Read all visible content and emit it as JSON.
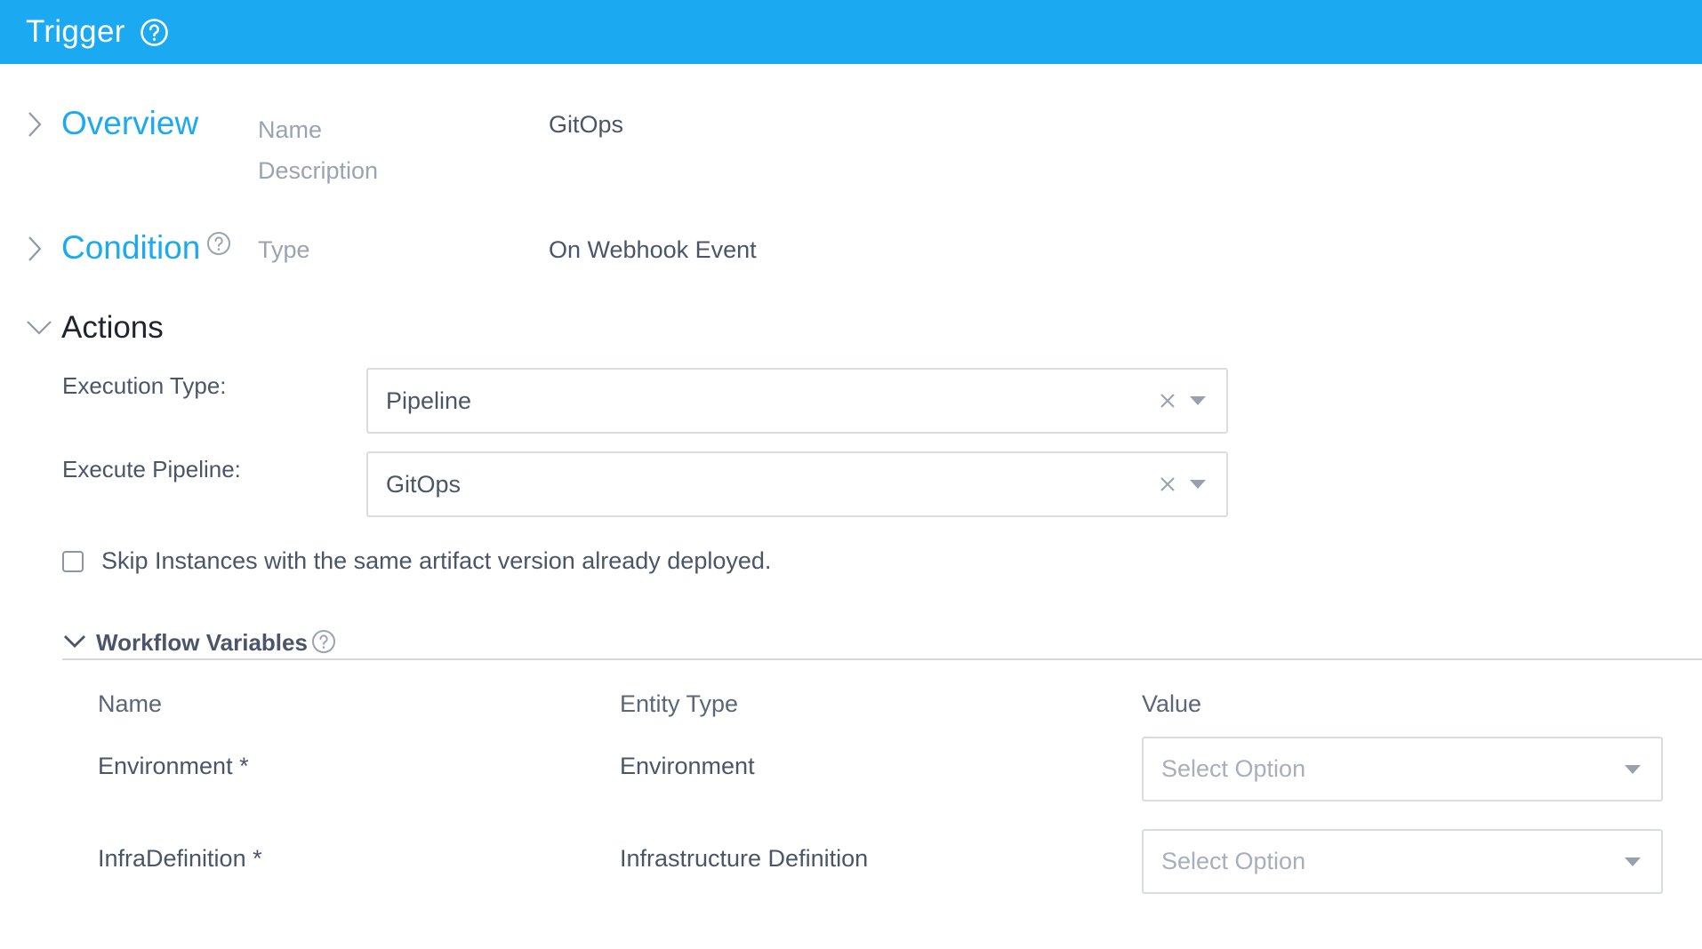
{
  "header": {
    "title": "Trigger",
    "help_icon": "help-circle-icon",
    "bg_color": "#1ba9f2"
  },
  "overview": {
    "heading": "Overview",
    "name_label": "Name",
    "name_value": "GitOps",
    "description_label": "Description"
  },
  "condition": {
    "heading": "Condition",
    "type_label": "Type",
    "type_value": "On Webhook Event"
  },
  "actions": {
    "heading": "Actions",
    "execution_type_label": "Execution Type:",
    "execution_type_value": "Pipeline",
    "execute_pipeline_label": "Execute Pipeline:",
    "execute_pipeline_value": "GitOps",
    "skip_instances_label": "Skip Instances with the same artifact version already deployed.",
    "skip_instances_checked": false
  },
  "workflow_variables": {
    "heading": "Workflow Variables",
    "columns": {
      "name": "Name",
      "entity_type": "Entity Type",
      "value": "Value"
    },
    "rows": [
      {
        "name": "Environment *",
        "entity_type": "Environment",
        "placeholder": "Select Option"
      },
      {
        "name": "InfraDefinition *",
        "entity_type": "Infrastructure Definition",
        "placeholder": "Select Option"
      }
    ]
  }
}
